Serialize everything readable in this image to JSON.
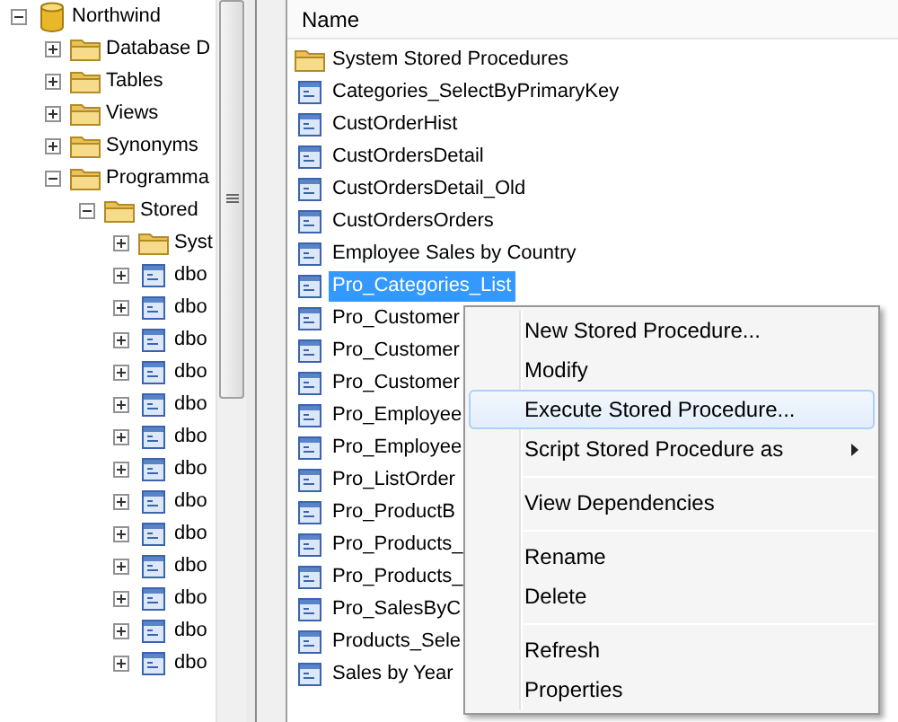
{
  "tree": [
    {
      "label": "Northwind",
      "kind": "database",
      "expanded": true,
      "children": [
        {
          "label": "Database D",
          "kind": "folder",
          "expanded": false
        },
        {
          "label": "Tables",
          "kind": "folder",
          "expanded": false
        },
        {
          "label": "Views",
          "kind": "folder",
          "expanded": false
        },
        {
          "label": "Synonyms",
          "kind": "folder",
          "expanded": false
        },
        {
          "label": "Programma",
          "kind": "folder",
          "expanded": true,
          "children": [
            {
              "label": "Stored",
              "kind": "folder",
              "expanded": true,
              "children": [
                {
                  "label": "Syst",
                  "kind": "folder",
                  "expanded": false
                },
                {
                  "label": "dbo",
                  "kind": "procedure",
                  "expanded": false
                },
                {
                  "label": "dbo",
                  "kind": "procedure",
                  "expanded": false
                },
                {
                  "label": "dbo",
                  "kind": "procedure",
                  "expanded": false
                },
                {
                  "label": "dbo",
                  "kind": "procedure",
                  "expanded": false
                },
                {
                  "label": "dbo",
                  "kind": "procedure",
                  "expanded": false
                },
                {
                  "label": "dbo",
                  "kind": "procedure",
                  "expanded": false
                },
                {
                  "label": "dbo",
                  "kind": "procedure",
                  "expanded": false
                },
                {
                  "label": "dbo",
                  "kind": "procedure",
                  "expanded": false
                },
                {
                  "label": "dbo",
                  "kind": "procedure",
                  "expanded": false
                },
                {
                  "label": "dbo",
                  "kind": "procedure",
                  "expanded": false
                },
                {
                  "label": "dbo",
                  "kind": "procedure",
                  "expanded": false
                },
                {
                  "label": "dbo",
                  "kind": "procedure",
                  "expanded": false
                },
                {
                  "label": "dbo",
                  "kind": "procedure",
                  "expanded": false
                }
              ]
            }
          ]
        }
      ]
    }
  ],
  "list": {
    "column": "Name",
    "items": [
      {
        "label": "System Stored Procedures",
        "kind": "folder",
        "selected": false
      },
      {
        "label": "Categories_SelectByPrimaryKey",
        "kind": "procedure",
        "selected": false
      },
      {
        "label": "CustOrderHist",
        "kind": "procedure",
        "selected": false
      },
      {
        "label": "CustOrdersDetail",
        "kind": "procedure",
        "selected": false
      },
      {
        "label": "CustOrdersDetail_Old",
        "kind": "procedure",
        "selected": false
      },
      {
        "label": "CustOrdersOrders",
        "kind": "procedure",
        "selected": false
      },
      {
        "label": "Employee Sales by Country",
        "kind": "procedure",
        "selected": false
      },
      {
        "label": "Pro_Categories_List",
        "kind": "procedure",
        "selected": true
      },
      {
        "label": "Pro_Customer",
        "kind": "procedure",
        "selected": false
      },
      {
        "label": "Pro_Customer",
        "kind": "procedure",
        "selected": false
      },
      {
        "label": "Pro_Customer",
        "kind": "procedure",
        "selected": false
      },
      {
        "label": "Pro_Employee",
        "kind": "procedure",
        "selected": false
      },
      {
        "label": "Pro_Employee",
        "kind": "procedure",
        "selected": false
      },
      {
        "label": "Pro_ListOrder",
        "kind": "procedure",
        "selected": false
      },
      {
        "label": "Pro_ProductB",
        "kind": "procedure",
        "selected": false
      },
      {
        "label": "Pro_Products_",
        "kind": "procedure",
        "selected": false
      },
      {
        "label": "Pro_Products_",
        "kind": "procedure",
        "selected": false
      },
      {
        "label": "Pro_SalesByC",
        "kind": "procedure",
        "selected": false
      },
      {
        "label": "Products_Sele",
        "kind": "procedure",
        "selected": false
      },
      {
        "label": "Sales by Year",
        "kind": "procedure",
        "selected": false
      }
    ]
  },
  "context_menu": {
    "groups": [
      [
        {
          "label": "New Stored Procedure...",
          "selected": false,
          "submenu": false
        },
        {
          "label": "Modify",
          "selected": false,
          "submenu": false
        },
        {
          "label": "Execute Stored Procedure...",
          "selected": true,
          "submenu": false
        },
        {
          "label": "Script Stored Procedure as",
          "selected": false,
          "submenu": true
        }
      ],
      [
        {
          "label": "View Dependencies",
          "selected": false,
          "submenu": false
        }
      ],
      [
        {
          "label": "Rename",
          "selected": false,
          "submenu": false
        },
        {
          "label": "Delete",
          "selected": false,
          "submenu": false
        }
      ],
      [
        {
          "label": "Refresh",
          "selected": false,
          "submenu": false
        },
        {
          "label": "Properties",
          "selected": false,
          "submenu": false
        }
      ]
    ]
  }
}
